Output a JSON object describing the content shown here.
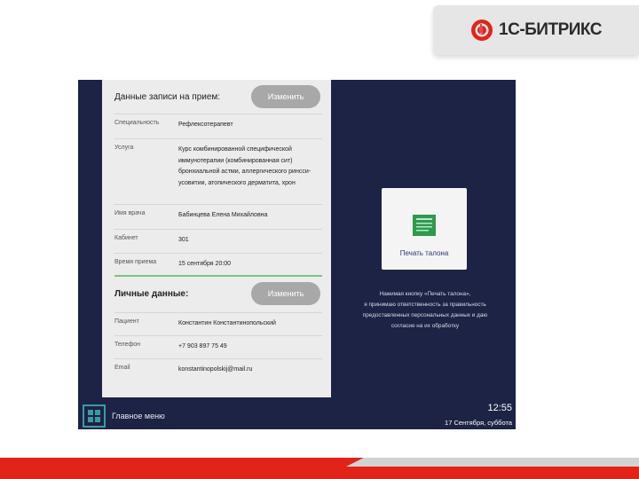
{
  "brand": {
    "name": "1С-БИТРИКС",
    "color": "#e2231a"
  },
  "appointment": {
    "title": "Данные записи на прием:",
    "edit_label": "Изменить",
    "rows": [
      {
        "key": "Специальность",
        "value": "Рефлексотерапевт"
      },
      {
        "key": "Услуга",
        "value": "Курс комбинированной специфической иммунотерапии (комбинированная сит) бронхиальной астми, аллергического ринсси-усовитии, атопического дерматита, хрон"
      },
      {
        "key": "Имя врача",
        "value": "Бабинцева Елена Михайловна"
      },
      {
        "key": "Кабинет",
        "value": "301"
      },
      {
        "key": "Время приема",
        "value": "15 сентября 20:00"
      }
    ]
  },
  "personal": {
    "title": "Личные данные:",
    "edit_label": "Изменить",
    "rows": [
      {
        "key": "Пациент",
        "value": "Константин Константинопольский"
      },
      {
        "key": "Телефон",
        "value": "+7 903 897 75 49"
      },
      {
        "key": "Email",
        "value": "konstantinopolskij@mail.ru"
      }
    ]
  },
  "print": {
    "label": "Печать талона",
    "icon": "ticket-icon",
    "icon_color": "#2e9a4e"
  },
  "consent_lines": [
    "Нажимая кнопку «Печать талона»,",
    "я принимаю ответственность за правильность",
    "предоставленных персональных данных и даю",
    "согласие на их обработку"
  ],
  "footer": {
    "menu_label": "Главное меню",
    "menu_icon": "grid-icon",
    "time": "12:55",
    "date": "17 Сентября, суббота"
  },
  "colors": {
    "screen_bg": "#1c2344",
    "accent_teal": "#3b9aa6",
    "edit_btn": "#a8a8a8"
  }
}
